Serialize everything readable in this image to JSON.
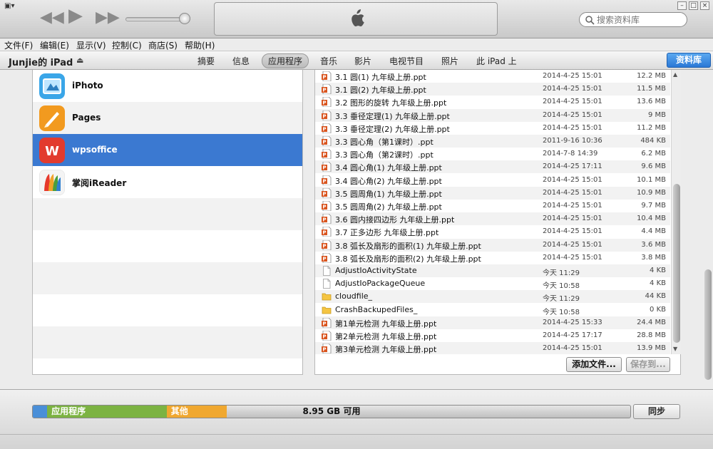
{
  "menu": [
    "文件(F)",
    "编辑(E)",
    "显示(V)",
    "控制(C)",
    "商店(S)",
    "帮助(H)"
  ],
  "search": {
    "placeholder": "搜索资料库"
  },
  "device": {
    "name": "Junjie的 iPad"
  },
  "tabs": [
    "摘要",
    "信息",
    "应用程序",
    "音乐",
    "影片",
    "电视节目",
    "照片",
    "此 iPad 上"
  ],
  "active_tab": "应用程序",
  "library_button": "资料库",
  "apps": [
    {
      "name": "iPhoto",
      "icon": "iphoto-icon",
      "color": "#3aa6e8"
    },
    {
      "name": "Pages",
      "icon": "pages-icon",
      "color": "#f29a1f"
    },
    {
      "name": "wpsoffice",
      "icon": "wps-icon",
      "color": "#e23b2e"
    },
    {
      "name": "掌阅iReader",
      "icon": "ireader-icon",
      "color": "#4a9e3c"
    }
  ],
  "selected_app": "wpsoffice",
  "files": [
    {
      "name": "3.1 圆(1) 九年级上册.ppt",
      "date": "2014-4-25 15:01",
      "size": "12.2 MB",
      "type": "ppt"
    },
    {
      "name": "3.1 圆(2) 九年级上册.ppt",
      "date": "2014-4-25 15:01",
      "size": "11.5 MB",
      "type": "ppt"
    },
    {
      "name": "3.2 图形的旋转 九年级上册.ppt",
      "date": "2014-4-25 15:01",
      "size": "13.6 MB",
      "type": "ppt"
    },
    {
      "name": "3.3 垂径定理(1) 九年级上册.ppt",
      "date": "2014-4-25 15:01",
      "size": "9 MB",
      "type": "ppt"
    },
    {
      "name": "3.3 垂径定理(2) 九年级上册.ppt",
      "date": "2014-4-25 15:01",
      "size": "11.2 MB",
      "type": "ppt"
    },
    {
      "name": "3.3 圆心角（第1课时）.ppt",
      "date": "2011-9-16 10:36",
      "size": "484 KB",
      "type": "ppt"
    },
    {
      "name": "3.3 圆心角（第2课时）.ppt",
      "date": "2014-7-8 14:39",
      "size": "6.2 MB",
      "type": "ppt"
    },
    {
      "name": "3.4 圆心角(1) 九年级上册.ppt",
      "date": "2014-4-25 17:11",
      "size": "9.6 MB",
      "type": "ppt"
    },
    {
      "name": "3.4 圆心角(2) 九年级上册.ppt",
      "date": "2014-4-25 15:01",
      "size": "10.1 MB",
      "type": "ppt"
    },
    {
      "name": "3.5 圆周角(1) 九年级上册.ppt",
      "date": "2014-4-25 15:01",
      "size": "10.9 MB",
      "type": "ppt"
    },
    {
      "name": "3.5 圆周角(2) 九年级上册.ppt",
      "date": "2014-4-25 15:01",
      "size": "9.7 MB",
      "type": "ppt"
    },
    {
      "name": "3.6 圆内接四边形 九年级上册.ppt",
      "date": "2014-4-25 15:01",
      "size": "10.4 MB",
      "type": "ppt"
    },
    {
      "name": "3.7 正多边形 九年级上册.ppt",
      "date": "2014-4-25 15:01",
      "size": "4.4 MB",
      "type": "ppt"
    },
    {
      "name": "3.8 弧长及扇形的面积(1) 九年级上册.ppt",
      "date": "2014-4-25 15:01",
      "size": "3.6 MB",
      "type": "ppt"
    },
    {
      "name": "3.8 弧长及扇形的面积(2) 九年级上册.ppt",
      "date": "2014-4-25 15:01",
      "size": "3.8 MB",
      "type": "ppt"
    },
    {
      "name": "AdjustIoActivityState",
      "date": "今天 11:29",
      "size": "4 KB",
      "type": "doc"
    },
    {
      "name": "AdjustIoPackageQueue",
      "date": "今天 10:58",
      "size": "4 KB",
      "type": "doc"
    },
    {
      "name": "cloudfile_",
      "date": "今天 11:29",
      "size": "44 KB",
      "type": "folder"
    },
    {
      "name": "CrashBackupedFiles_",
      "date": "今天 10:58",
      "size": "0 KB",
      "type": "folder"
    },
    {
      "name": "第1单元检测 九年级上册.ppt",
      "date": "2014-4-25 15:33",
      "size": "24.4 MB",
      "type": "ppt"
    },
    {
      "name": "第2单元检测 九年级上册.ppt",
      "date": "2014-4-25 17:17",
      "size": "28.8 MB",
      "type": "ppt"
    },
    {
      "name": "第3单元检测 九年级上册.ppt",
      "date": "2014-4-25 15:01",
      "size": "13.9 MB",
      "type": "ppt"
    }
  ],
  "buttons": {
    "add_file": "添加文件...",
    "save_to": "保存到..."
  },
  "capacity": {
    "segments": [
      {
        "label": "",
        "fraction": 0.024,
        "color": "#4a8fd8"
      },
      {
        "label": "应用程序",
        "fraction": 0.2,
        "color": "#7cb342"
      },
      {
        "label": "其他",
        "fraction": 0.1,
        "color": "#f0a830"
      }
    ],
    "free_label": "8.95 GB 可用"
  },
  "sync_button": "同步"
}
